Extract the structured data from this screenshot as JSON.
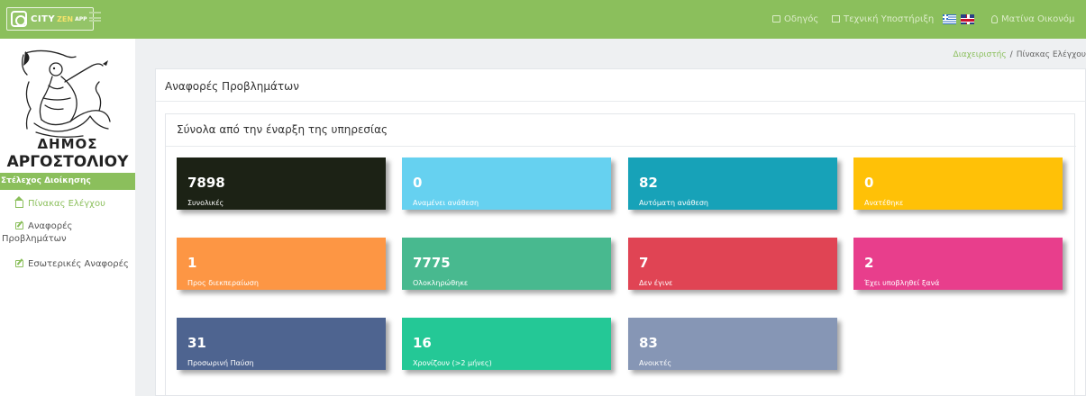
{
  "topbar": {
    "logo": {
      "city": "CITY",
      "zen": "ZEN",
      "app": "APP"
    },
    "links": {
      "guide": "Οδηγός",
      "support": "Τεχνική Υποστήριξη",
      "user": "Ματίνα Οικονόμ"
    },
    "icons": [
      "guide-icon",
      "mail-icon",
      "user-icon"
    ],
    "flags": [
      "greek-flag",
      "uk-flag"
    ]
  },
  "sidebar": {
    "municipality": [
      "ΔΗΜΟΣ",
      "ΑΡΓΟΣΤΟΛΙΟΥ"
    ],
    "role": "Στέλεχος Διοίκησης",
    "items": [
      {
        "label": "Πίνακας Ελέγχου",
        "icon": "home-icon"
      },
      {
        "label_line1": "Αναφορές",
        "label_line2": "Προβλημάτων",
        "icon": "edit-icon"
      },
      {
        "label": "Εσωτερικές Αναφορές",
        "icon": "edit-icon"
      }
    ]
  },
  "breadcrumb": {
    "parent": "Διαχειριστής",
    "separator": "/",
    "current": "Πίνακας Ελέγχου"
  },
  "main": {
    "panel_title": "Αναφορές Προβλημάτων",
    "inner_title": "Σύνολα από την έναρξη της υπηρεσίας",
    "cards": [
      {
        "value": "7898",
        "label": "Συνολικές",
        "color": "#1c2215"
      },
      {
        "value": "0",
        "label": "Αναμένει ανάθεση",
        "color": "#66d1f0"
      },
      {
        "value": "82",
        "label": "Αυτόματη ανάθεση",
        "color": "#17a2b8"
      },
      {
        "value": "0",
        "label": "Ανατέθηκε",
        "color": "#ffc107"
      },
      {
        "value": "1",
        "label": "Προς διεκπεραίωση",
        "color": "#fd9644"
      },
      {
        "value": "7775",
        "label": "Ολοκληρώθηκε",
        "color": "#48b98f"
      },
      {
        "value": "7",
        "label": "Δεν έγινε",
        "color": "#e04454"
      },
      {
        "value": "2",
        "label": "Έχει υποβληθεί ξανά",
        "color": "#e83e8c"
      },
      {
        "value": "31",
        "label": "Προσωρινή Παύση",
        "color": "#4e6490"
      },
      {
        "value": "16",
        "label": "Χρονίζουν (>2 μήνες)",
        "color": "#24c896"
      },
      {
        "value": "83",
        "label": "Ανοικτές",
        "color": "#8696b5"
      }
    ]
  }
}
